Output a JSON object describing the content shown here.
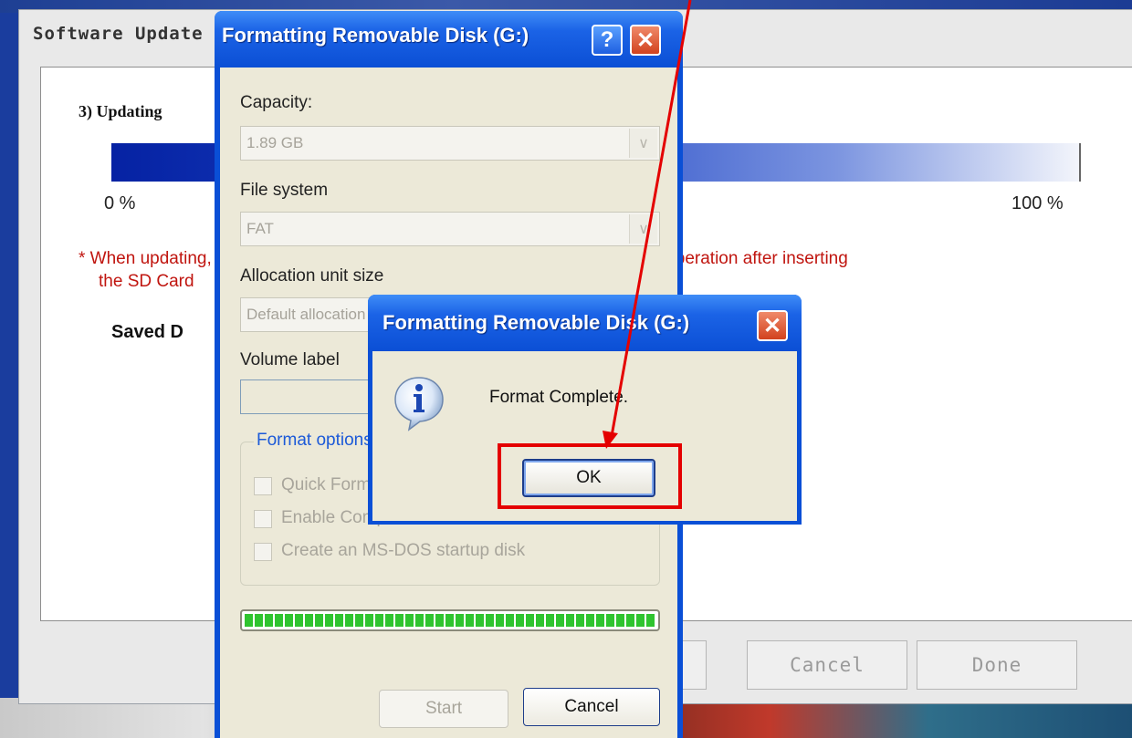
{
  "updater": {
    "title": "Software Update",
    "step_label": "3) Updating",
    "progress_percent": 100,
    "progress_start": "0 %",
    "progress_end": "100 %",
    "warning_line1": "* When updating, unplugging the power or the SD Card may prevent normal operation after inserting",
    "warning_line2": "the SD Card",
    "saved_label": "Saved D",
    "buttons": {
      "cancel": "Cancel",
      "done": "Done"
    }
  },
  "format_dialog": {
    "title": "Formatting Removable Disk (G:)",
    "help_symbol": "?",
    "close_symbol": "✕",
    "capacity_label": "Capacity:",
    "capacity_value": "1.89 GB",
    "file_system_label": "File system",
    "file_system_value": "FAT",
    "allocation_label": "Allocation unit size",
    "allocation_value": "Default allocation size",
    "volume_label": "Volume label",
    "volume_value": "",
    "format_options_title": "Format options",
    "options": [
      "Quick Format",
      "Enable Compression",
      "Create an MS-DOS startup disk"
    ],
    "progress_percent": 100,
    "start_label": "Start",
    "cancel_label": "Cancel"
  },
  "message_box": {
    "title": "Formatting Removable Disk (G:)",
    "close_symbol": "✕",
    "icon": "info-icon",
    "message": "Format Complete.",
    "ok_label": "OK"
  },
  "annotation": {
    "color": "#e40000",
    "arrow_icon": "red-arrow-icon"
  }
}
